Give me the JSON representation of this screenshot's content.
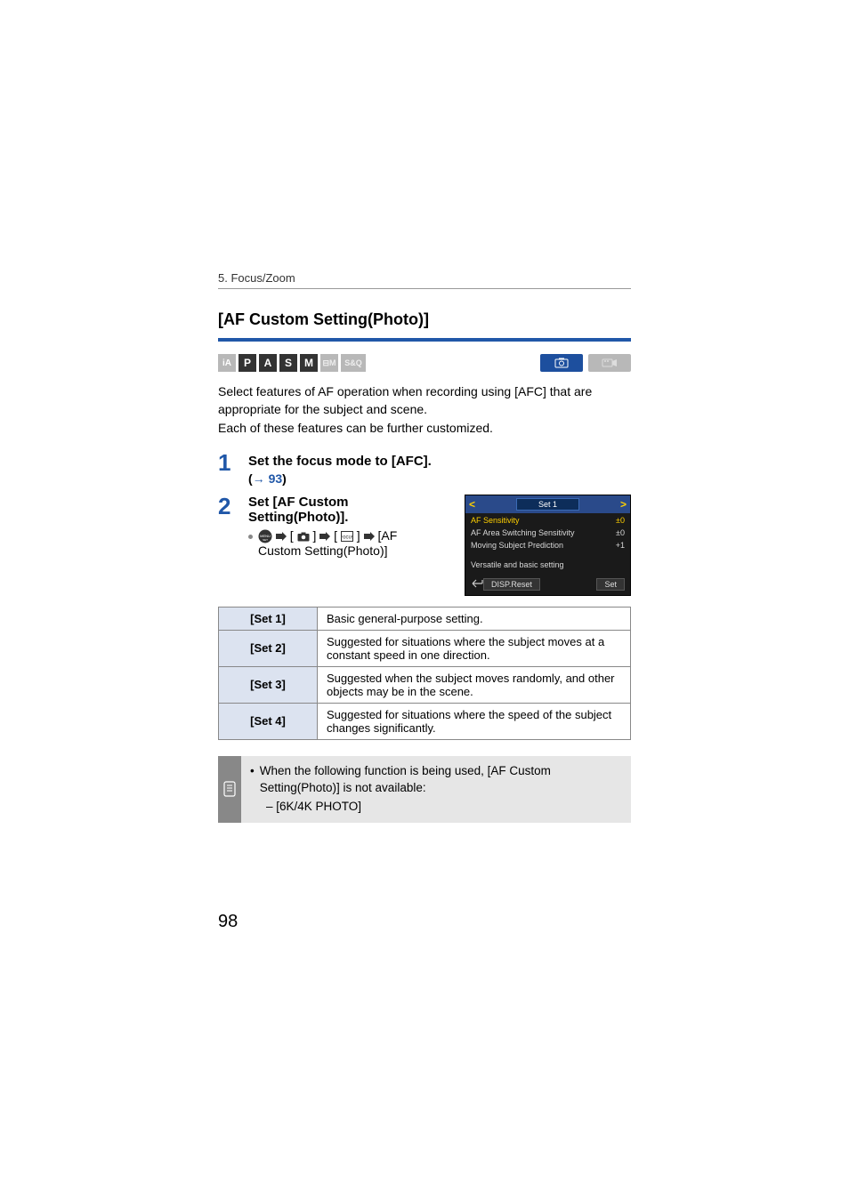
{
  "breadcrumb": "5. Focus/Zoom",
  "section_title": "[AF Custom Setting(Photo)]",
  "mode_icons": [
    "iA",
    "P",
    "A",
    "S",
    "M",
    "⊟M",
    "S&Q"
  ],
  "intro": {
    "l1": "Select features of AF operation when recording using [AFC] that are appropriate for the subject and scene.",
    "l2": "Each of these features can be further customized."
  },
  "steps": {
    "s1": {
      "num": "1",
      "title": "Set the focus mode to [AFC].",
      "ref_open": "(",
      "ref_arrow": "→",
      "ref_page": "93",
      "ref_close": ")"
    },
    "s2": {
      "num": "2",
      "title": "Set [AF Custom Setting(Photo)].",
      "path_suffix": "[AF Custom Setting(Photo)]"
    }
  },
  "cam_preview": {
    "set_title": "Set 1",
    "rows": [
      {
        "label": "AF Sensitivity",
        "value": "±0",
        "sel": true
      },
      {
        "label": "AF Area Switching Sensitivity",
        "value": "±0",
        "sel": false
      },
      {
        "label": "Moving Subject Prediction",
        "value": "+1",
        "sel": false
      }
    ],
    "desc": "Versatile and basic setting",
    "reset": "DISP.Reset",
    "set_btn": "Set"
  },
  "set_table": [
    {
      "name": "[Set 1]",
      "desc": "Basic general-purpose setting."
    },
    {
      "name": "[Set 2]",
      "desc": "Suggested for situations where the subject moves at a constant speed in one direction."
    },
    {
      "name": "[Set 3]",
      "desc": "Suggested when the subject moves randomly, and other objects may be in the scene."
    },
    {
      "name": "[Set 4]",
      "desc": "Suggested for situations where the speed of the subject changes significantly."
    }
  ],
  "note": {
    "text": "When the following function is being used, [AF Custom Setting(Photo)] is not available:",
    "sub": "– [6K/4K PHOTO]"
  },
  "page_number": "98"
}
